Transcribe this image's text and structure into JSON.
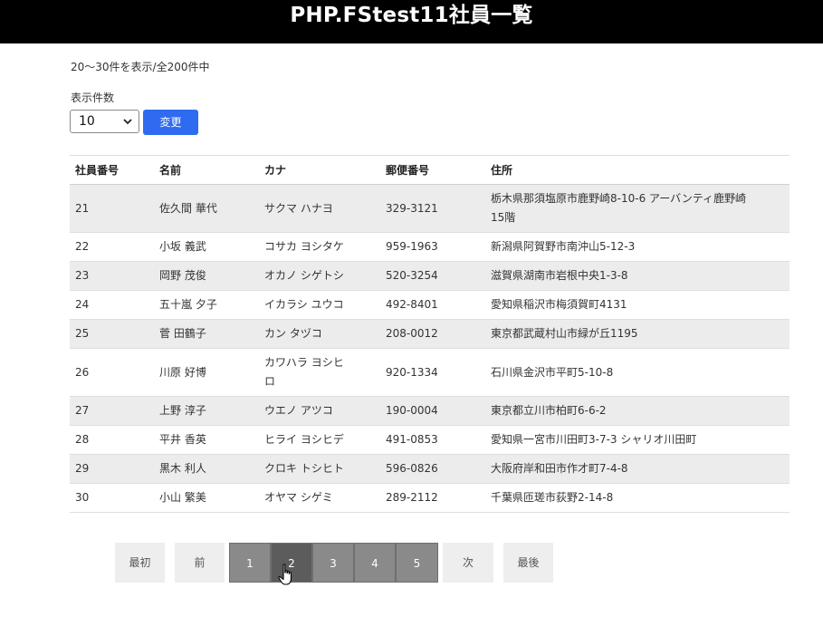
{
  "header": {
    "title": "PHP.FStest11社員一覧"
  },
  "range_text": "20～30件を表示/全200件中",
  "per_page": {
    "label": "表示件数",
    "selected": "10",
    "button": "変更"
  },
  "table": {
    "columns": [
      "社員番号",
      "名前",
      "カナ",
      "郵便番号",
      "住所"
    ],
    "rows": [
      [
        "21",
        "佐久間 華代",
        "サクマ ハナヨ",
        "329-3121",
        "栃木県那須塩原市鹿野崎8-10-6 アーバンティ鹿野崎 15階"
      ],
      [
        "22",
        "小坂 義武",
        "コサカ ヨシタケ",
        "959-1963",
        "新潟県阿賀野市南沖山5-12-3"
      ],
      [
        "23",
        "岡野 茂俊",
        "オカノ シゲトシ",
        "520-3254",
        "滋賀県湖南市岩根中央1-3-8"
      ],
      [
        "24",
        "五十嵐 夕子",
        "イカラシ ユウコ",
        "492-8401",
        "愛知県稲沢市梅須賀町4131"
      ],
      [
        "25",
        "菅 田鶴子",
        "カン タヅコ",
        "208-0012",
        "東京都武蔵村山市緑が丘1195"
      ],
      [
        "26",
        "川原 好博",
        "カワハラ ヨシヒロ",
        "920-1334",
        "石川県金沢市平町5-10-8"
      ],
      [
        "27",
        "上野 淳子",
        "ウエノ アツコ",
        "190-0004",
        "東京都立川市柏町6-6-2"
      ],
      [
        "28",
        "平井 香英",
        "ヒライ ヨシヒデ",
        "491-0853",
        "愛知県一宮市川田町3-7-3 シャリオ川田町"
      ],
      [
        "29",
        "黒木 利人",
        "クロキ トシヒト",
        "596-0826",
        "大阪府岸和田市作才町7-4-8"
      ],
      [
        "30",
        "小山 繁美",
        "オヤマ シゲミ",
        "289-2112",
        "千葉県匝瑳市荻野2-14-8"
      ]
    ]
  },
  "pagination": {
    "first": "最初",
    "prev": "前",
    "pages": [
      "1",
      "2",
      "3",
      "4",
      "5"
    ],
    "current": "2",
    "next": "次",
    "last": "最後"
  },
  "colors": {
    "header_bg": "#000000",
    "button_blue": "#2f6bf0",
    "page_active": "#5c5c5c",
    "page_inactive": "#8a8a8a"
  }
}
